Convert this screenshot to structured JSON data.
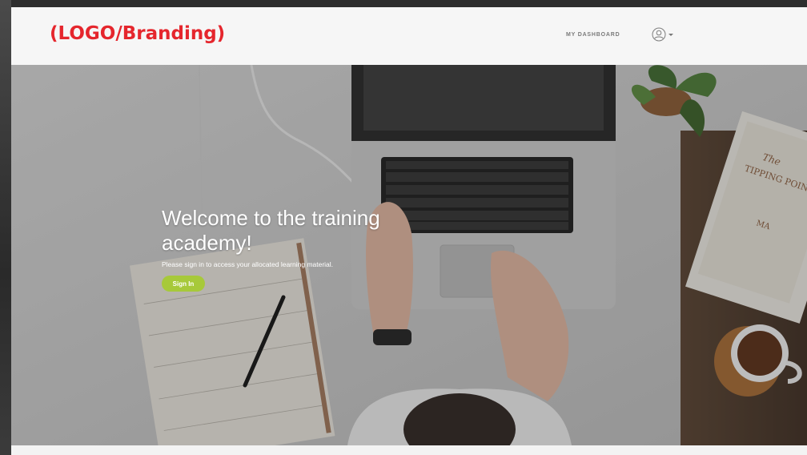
{
  "header": {
    "logo_text": "(LOGO/Branding)",
    "nav_dashboard": "MY DASHBOARD",
    "user_icon": "user-avatar-icon"
  },
  "hero": {
    "title": "Welcome to the training academy!",
    "subtitle": "Please sign in to access your allocated learning material.",
    "signin_label": "Sign In"
  },
  "colors": {
    "brand_red": "#e5262d",
    "signin_green": "#a7c93a",
    "header_bg": "#f6f6f6"
  }
}
